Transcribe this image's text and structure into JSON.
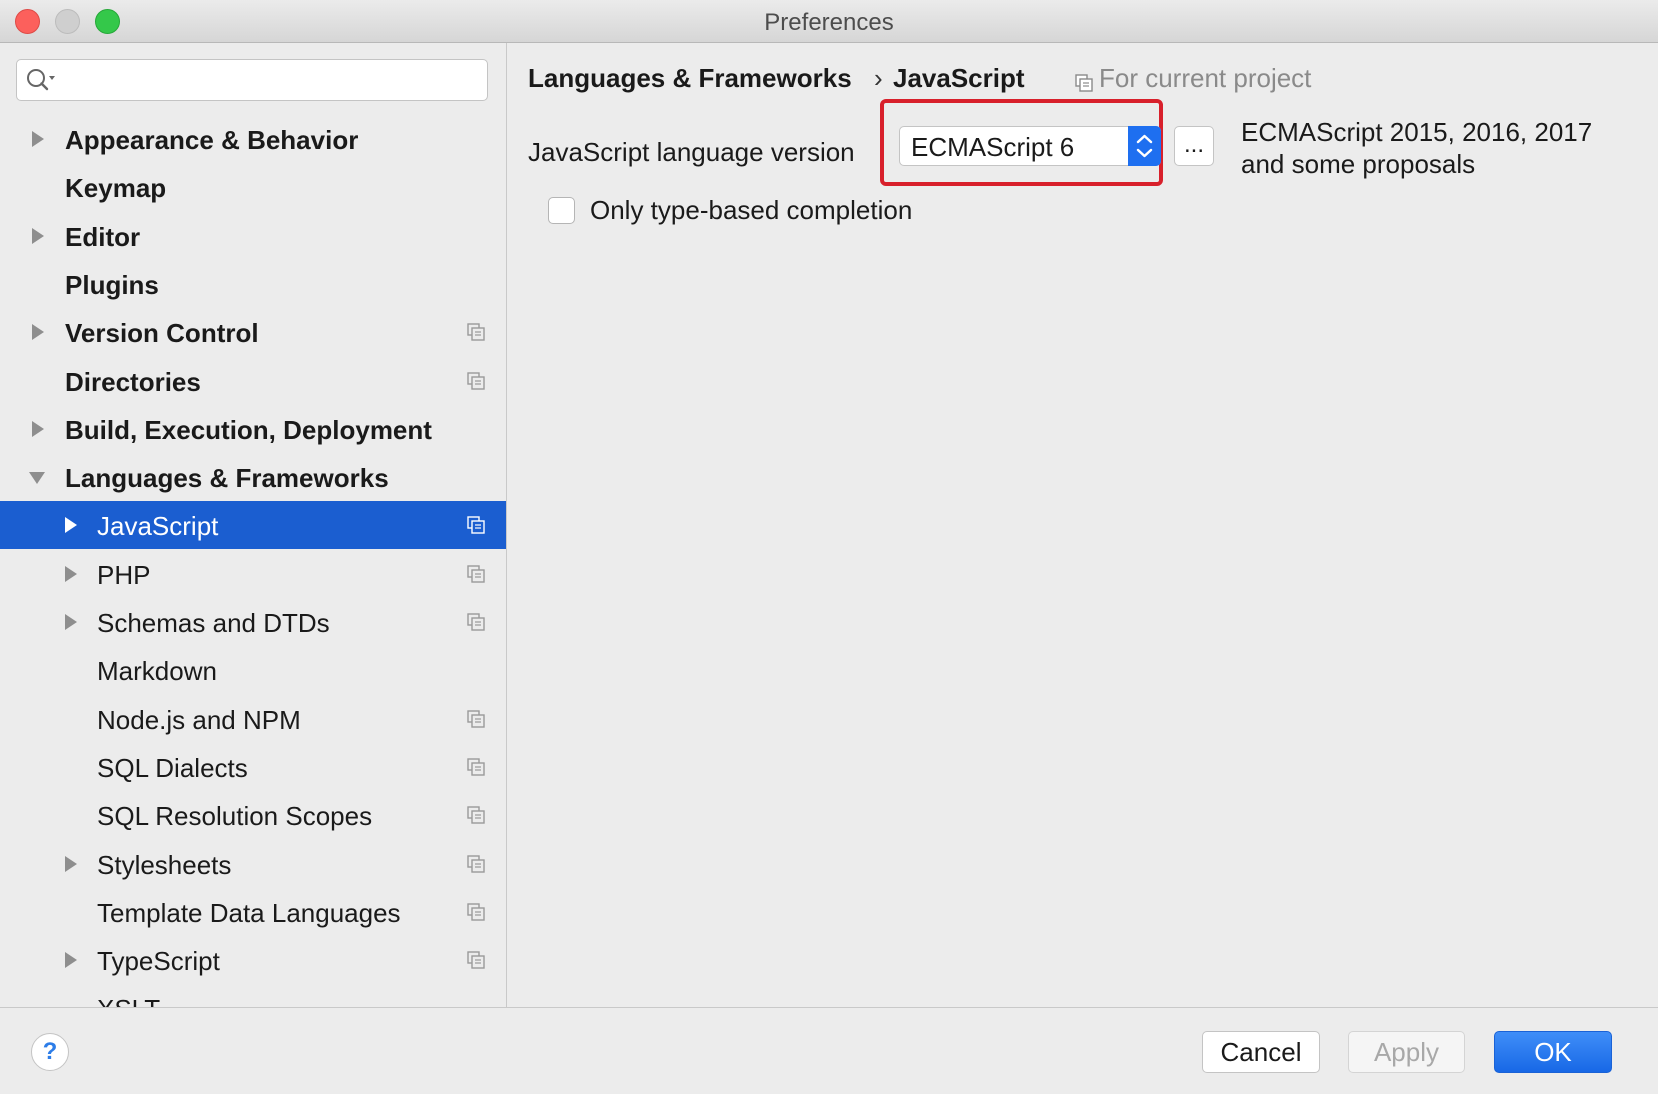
{
  "window": {
    "title": "Preferences"
  },
  "search": {
    "value": "",
    "placeholder": ""
  },
  "sidebar": {
    "items": [
      {
        "label": "Appearance & Behavior",
        "bold": true,
        "expandable": true,
        "expanded": false,
        "indent": 0,
        "project": false
      },
      {
        "label": "Keymap",
        "bold": true,
        "expandable": false,
        "indent": 0,
        "project": false
      },
      {
        "label": "Editor",
        "bold": true,
        "expandable": true,
        "expanded": false,
        "indent": 0,
        "project": false
      },
      {
        "label": "Plugins",
        "bold": true,
        "expandable": false,
        "indent": 0,
        "project": false
      },
      {
        "label": "Version Control",
        "bold": true,
        "expandable": true,
        "expanded": false,
        "indent": 0,
        "project": true
      },
      {
        "label": "Directories",
        "bold": true,
        "expandable": false,
        "indent": 0,
        "project": true
      },
      {
        "label": "Build, Execution, Deployment",
        "bold": true,
        "expandable": true,
        "expanded": false,
        "indent": 0,
        "project": false
      },
      {
        "label": "Languages & Frameworks",
        "bold": true,
        "expandable": true,
        "expanded": true,
        "indent": 0,
        "project": false
      },
      {
        "label": "JavaScript",
        "bold": false,
        "expandable": true,
        "expanded": false,
        "indent": 1,
        "project": true,
        "selected": true
      },
      {
        "label": "PHP",
        "bold": false,
        "expandable": true,
        "expanded": false,
        "indent": 1,
        "project": true
      },
      {
        "label": "Schemas and DTDs",
        "bold": false,
        "expandable": true,
        "expanded": false,
        "indent": 1,
        "project": true
      },
      {
        "label": "Markdown",
        "bold": false,
        "expandable": false,
        "indent": 1,
        "project": false
      },
      {
        "label": "Node.js and NPM",
        "bold": false,
        "expandable": false,
        "indent": 1,
        "project": true
      },
      {
        "label": "SQL Dialects",
        "bold": false,
        "expandable": false,
        "indent": 1,
        "project": true
      },
      {
        "label": "SQL Resolution Scopes",
        "bold": false,
        "expandable": false,
        "indent": 1,
        "project": true
      },
      {
        "label": "Stylesheets",
        "bold": false,
        "expandable": true,
        "expanded": false,
        "indent": 1,
        "project": true
      },
      {
        "label": "Template Data Languages",
        "bold": false,
        "expandable": false,
        "indent": 1,
        "project": true
      },
      {
        "label": "TypeScript",
        "bold": false,
        "expandable": true,
        "expanded": false,
        "indent": 1,
        "project": true
      },
      {
        "label": "XSLT",
        "bold": false,
        "expandable": false,
        "indent": 1,
        "project": false
      }
    ]
  },
  "content": {
    "breadcrumb": {
      "parent": "Languages & Frameworks",
      "separator": "›",
      "current": "JavaScript",
      "scope": "For current project"
    },
    "language_version": {
      "label": "JavaScript language version",
      "selected": "ECMAScript 6",
      "more_label": "...",
      "description_line1": "ECMAScript 2015, 2016, 2017",
      "description_line2": "and some proposals"
    },
    "type_based_completion": {
      "label": "Only type-based completion",
      "checked": false
    }
  },
  "footer": {
    "help_label": "?",
    "cancel_label": "Cancel",
    "apply_label": "Apply",
    "ok_label": "OK"
  },
  "colors": {
    "selection": "#1b5ed0",
    "highlight_box": "#d8202b",
    "ok_button": "#1868e6",
    "traffic_close": "#fc605c",
    "traffic_max": "#34c84a"
  },
  "icons": {
    "search": "search-icon",
    "expand_collapsed": "triangle-right-icon",
    "expand_open": "triangle-down-icon",
    "project_scope": "project-scope-icon",
    "stepper": "up-down-chevron-icon"
  }
}
